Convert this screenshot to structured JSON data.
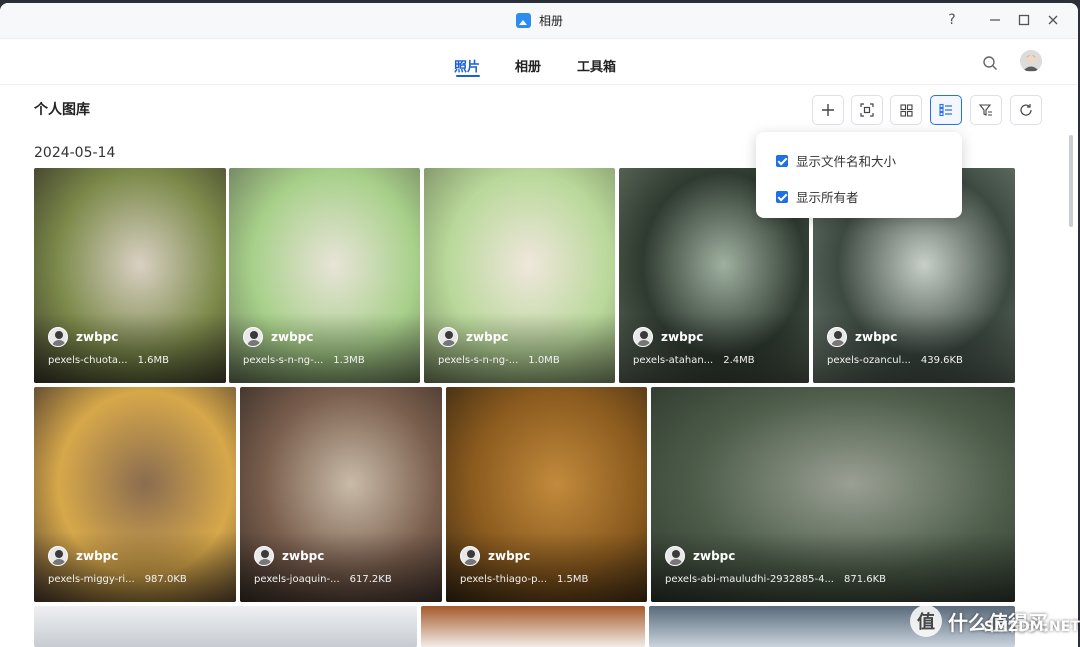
{
  "window": {
    "title": "相册",
    "help_icon": "question-icon",
    "minimize_icon": "minimize-icon",
    "maximize_icon": "maximize-icon",
    "close_icon": "close-icon"
  },
  "tabs": [
    {
      "label": "照片",
      "active": true
    },
    {
      "label": "相册",
      "active": false
    },
    {
      "label": "工具箱",
      "active": false
    }
  ],
  "header": {
    "search_icon": "search-icon",
    "avatar_icon": "user-avatar"
  },
  "library": {
    "title": "个人图库",
    "date": "2024-05-14"
  },
  "toolbar": [
    {
      "name": "add",
      "icon": "plus-icon"
    },
    {
      "name": "face-scan",
      "icon": "scan-icon"
    },
    {
      "name": "grid-view",
      "icon": "grid-icon"
    },
    {
      "name": "display-options",
      "icon": "list-settings-icon",
      "active": true
    },
    {
      "name": "filter",
      "icon": "filter-icon"
    },
    {
      "name": "refresh",
      "icon": "refresh-icon"
    }
  ],
  "display_menu": {
    "items": [
      {
        "label": "显示文件名和大小",
        "checked": true
      },
      {
        "label": "显示所有者",
        "checked": true
      }
    ]
  },
  "photos_row1": [
    {
      "owner": "zwbpc",
      "filename": "pexels-chuota...",
      "size": "1.6MB",
      "palette": [
        "#7c8a4a",
        "#d9d0c3",
        "#3c3a2a"
      ]
    },
    {
      "owner": "zwbpc",
      "filename": "pexels-s-n-ng-...",
      "size": "1.3MB",
      "palette": [
        "#a8d08a",
        "#e8e4d8",
        "#6a7a5a"
      ]
    },
    {
      "owner": "zwbpc",
      "filename": "pexels-s-n-ng-...",
      "size": "1.0MB",
      "palette": [
        "#b9d89a",
        "#efe7dc",
        "#7a8c62"
      ]
    },
    {
      "owner": "zwbpc",
      "filename": "pexels-atahan...",
      "size": "2.4MB",
      "palette": [
        "#2f3a30",
        "#9fb0a0",
        "#5d6b5a"
      ]
    },
    {
      "owner": "zwbpc",
      "filename": "pexels-ozancul...",
      "size": "439.6KB",
      "palette": [
        "#3d4a42",
        "#c7cfc8",
        "#6e7c70"
      ]
    }
  ],
  "photos_row2": [
    {
      "owner": "zwbpc",
      "filename": "pexels-miggy-ri...",
      "size": "987.0KB",
      "palette": [
        "#d7a84a",
        "#8a6c50",
        "#4d3c2e"
      ]
    },
    {
      "owner": "zwbpc",
      "filename": "pexels-joaquin-...",
      "size": "617.2KB",
      "palette": [
        "#7a5e4d",
        "#c9bba8",
        "#3a2f28"
      ]
    },
    {
      "owner": "zwbpc",
      "filename": "pexels-thiago-p...",
      "size": "1.5MB",
      "palette": [
        "#8a5a1e",
        "#c28a3c",
        "#3b2a14"
      ]
    },
    {
      "owner": "zwbpc",
      "filename": "pexels-abi-mauludhi-2932885-4...",
      "size": "871.6KB",
      "palette": [
        "#4d5d4a",
        "#9aa094",
        "#2d362c"
      ]
    }
  ],
  "photos_row3": [
    {
      "palette": [
        "#c8ccd2",
        "#eef0f2"
      ]
    },
    {
      "palette": [
        "#f3ece6",
        "#a55a2a"
      ]
    },
    {
      "palette": [
        "#c9d4de",
        "#5a6a7a"
      ]
    }
  ],
  "watermark": {
    "glyph": "值",
    "text": "什么值得买",
    "sub": "SMZDM.NET"
  }
}
